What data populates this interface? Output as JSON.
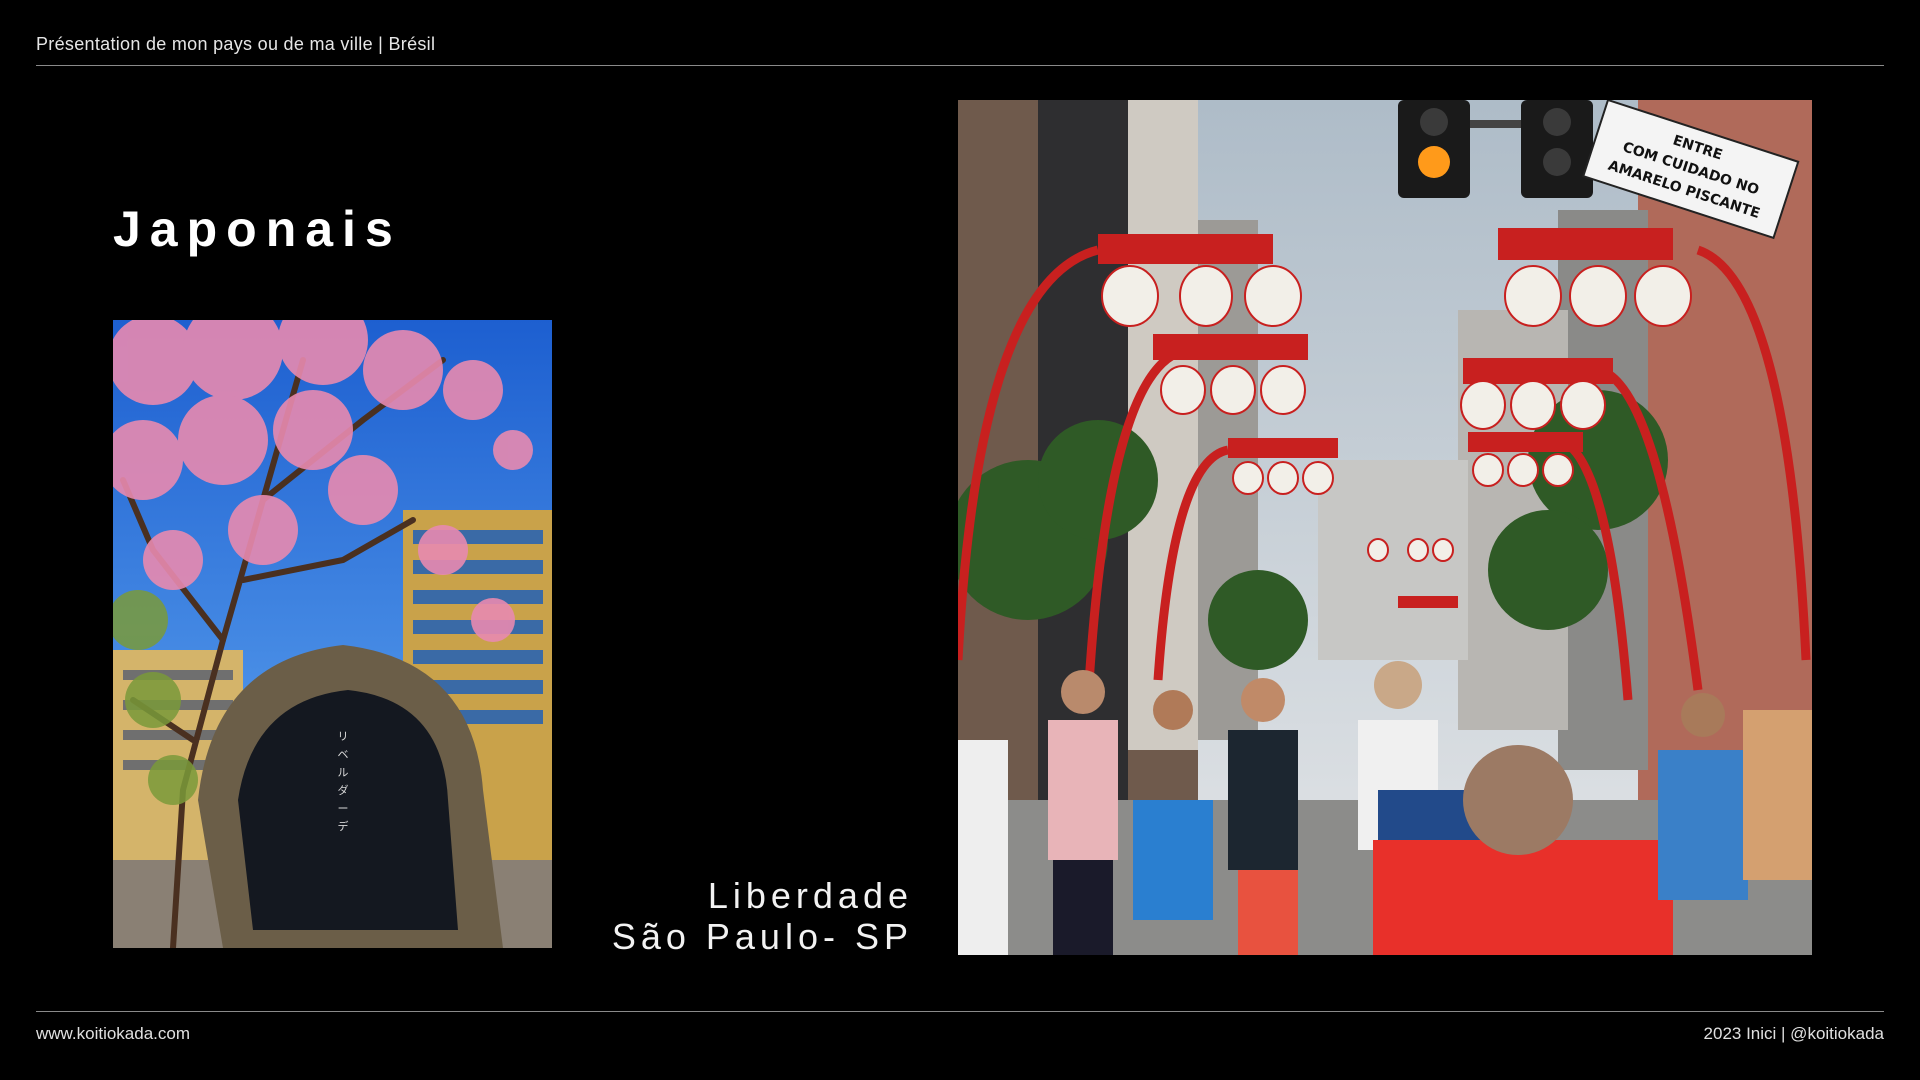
{
  "header": {
    "text": "Présentation de mon pays ou de ma ville | Brésil"
  },
  "slide": {
    "title": "Japonais",
    "caption_line1": "Liberdade",
    "caption_line2": "São Paulo- SP"
  },
  "images": {
    "left": {
      "alt": "Cherry blossom tree and Liberdade-Japan plaza stone monument"
    },
    "right": {
      "alt": "Liberdade street with red arches and white Japanese lanterns, crowd of pedestrians"
    }
  },
  "street_sign": {
    "line1": "ENTRE",
    "line2": "COM CUIDADO NO",
    "line3": "AMARELO PISCANTE"
  },
  "footer": {
    "left": "www.koitiokada.com",
    "right": "2023 Inici | @koitiokada"
  },
  "colors": {
    "background": "#000000",
    "text": "#ffffff",
    "rule": "#8a8a8a",
    "lantern_red": "#c8201f"
  }
}
